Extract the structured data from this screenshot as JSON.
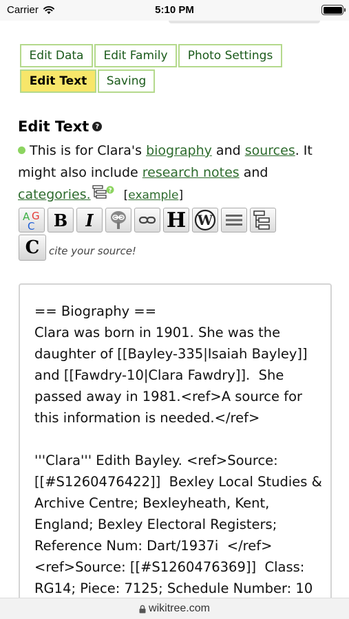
{
  "status_bar": {
    "carrier": "Carrier",
    "time": "5:10 PM",
    "battery_level": 1.0
  },
  "tabs": [
    {
      "label": "Edit Data",
      "active": false
    },
    {
      "label": "Edit Family",
      "active": false
    },
    {
      "label": "Photo Settings",
      "active": false
    },
    {
      "label": "Edit Text",
      "active": true
    },
    {
      "label": "Saving",
      "active": false
    }
  ],
  "section": {
    "title": "Edit Text",
    "help_icon": "question-icon"
  },
  "description": {
    "part1": "This is for Clara's ",
    "link_biography": "biography",
    "part2": " and ",
    "link_sources": "sources",
    "part3": ". It might also include ",
    "link_research_notes": "research notes",
    "part4": " and ",
    "link_categories": "categories.",
    "example_open": "[",
    "link_example": "example",
    "example_close": "]"
  },
  "toolbar": {
    "buttons": [
      {
        "name": "spellcheck-button",
        "icon": "spellcheck-icon"
      },
      {
        "name": "bold-button",
        "icon": "bold-icon",
        "glyph": "B"
      },
      {
        "name": "italic-button",
        "icon": "italic-icon",
        "glyph": "I"
      },
      {
        "name": "wikitree-link-button",
        "icon": "tree-link-icon"
      },
      {
        "name": "link-button",
        "icon": "link-icon"
      },
      {
        "name": "heading-button",
        "icon": "heading-icon",
        "glyph": "H"
      },
      {
        "name": "wikipedia-button",
        "icon": "wikipedia-icon"
      },
      {
        "name": "horizontal-rule-button",
        "icon": "horizontal-rule-icon"
      },
      {
        "name": "category-button",
        "icon": "category-tree-icon"
      }
    ],
    "cite_glyph": "C",
    "cite_label": "cite your source!"
  },
  "editor": {
    "content": "== Biography ==\nClara was born in 1901. She was the daughter of [[Bayley-335|Isaiah Bayley]] and [[Fawdry-10|Clara Fawdry]].  She passed away in 1981.<ref>A source for this information is needed.</ref>\n\n'''Clara''' Edith Bayley. <ref>Source: [[#S1260476422]]  Bexley Local Studies & Archive Centre; Bexleyheath, Kent, England; Bexley Electoral Registers; Reference Num: Dart/1937i  </ref>\n<ref>Source: [[#S1260476369]]  Class: RG14; Piece: 7125; Schedule Number: 10"
  },
  "browser": {
    "url": "wikitree.com",
    "lock_icon": "lock-icon"
  },
  "colors": {
    "tab_border": "#b4d98c",
    "tab_active": "#f7e66a",
    "link": "#2d6b2d",
    "bullet": "#8cd460"
  }
}
